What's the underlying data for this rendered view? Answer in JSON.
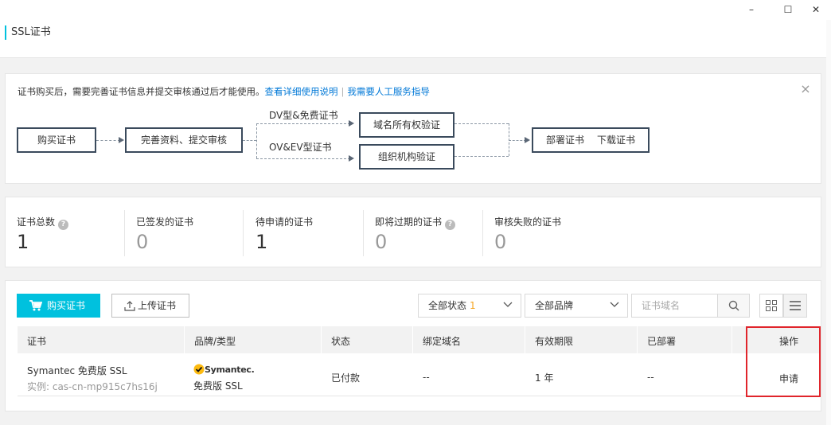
{
  "window": {
    "minimize": "–",
    "maximize": "☐",
    "close": "✕"
  },
  "header": {
    "title": "SSL证书"
  },
  "notice": {
    "text": "证书购买后，需要完善证书信息并提交审核通过后才能使用。",
    "link1": "查看详细使用说明",
    "separator": "|",
    "link2": "我需要人工服务指导",
    "close": "×"
  },
  "flow": {
    "buy": "购买证书",
    "complete": "完善资料、提交审核",
    "dv_label": "DV型&免费证书",
    "ov_label": "OV&EV型证书",
    "domain_verify": "域名所有权验证",
    "org_verify": "组织机构验证",
    "deploy": "部署证书",
    "download": "下载证书"
  },
  "stats": [
    {
      "label": "证书总数",
      "value": "1",
      "help": true
    },
    {
      "label": "已签发的证书",
      "value": "0",
      "help": false
    },
    {
      "label": "待申请的证书",
      "value": "1",
      "help": false
    },
    {
      "label": "即将过期的证书",
      "value": "0",
      "help": true
    },
    {
      "label": "审核失败的证书",
      "value": "0",
      "help": false
    }
  ],
  "toolbar": {
    "buy": "购买证书",
    "upload": "上传证书",
    "status_select": "全部状态",
    "status_badge": "1",
    "brand_select": "全部品牌",
    "search_placeholder": "证书域名"
  },
  "table": {
    "columns": [
      "证书",
      "品牌/类型",
      "状态",
      "绑定域名",
      "有效期限",
      "已部署",
      "操作"
    ],
    "rows": [
      {
        "cert": "Symantec 免费版 SSL",
        "instance": "实例: cas-cn-mp915c7hs16j",
        "brand_logo": "Symantec.",
        "brand_type": "免费版 SSL",
        "status": "已付款",
        "domain": "--",
        "validity": "1 年",
        "deployed": "--",
        "action": "申请"
      }
    ]
  },
  "colors": {
    "accent": "#00c1de",
    "link": "#0078d7",
    "highlight": "#e0252b",
    "badge": "#f5a623"
  }
}
